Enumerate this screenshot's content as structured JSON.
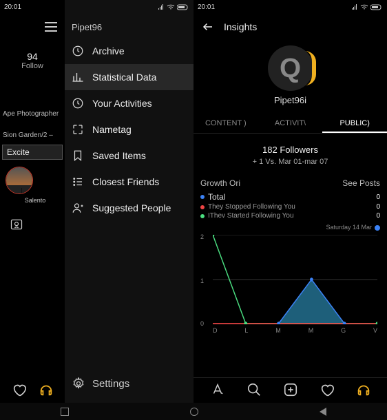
{
  "statusbar": {
    "time": "20:01"
  },
  "profile": {
    "follow_count": "94",
    "follow_label": "Follow",
    "role": "Ape Photographer",
    "location": "Sion Garden/2 –",
    "excite": "Excite",
    "story_label": "Salento"
  },
  "menu": {
    "username": "Pipet96",
    "items": [
      {
        "label": "Archive"
      },
      {
        "label": "Statistical Data"
      },
      {
        "label": "Your Activities"
      },
      {
        "label": "Nametag"
      },
      {
        "label": "Saved Items"
      },
      {
        "label": "Closest Friends"
      },
      {
        "label": "Suggested People"
      }
    ],
    "settings": "Settings"
  },
  "insights": {
    "title": "Insights",
    "username": "Pipet96i",
    "tabs": {
      "content": "CONTENT )",
      "activity": "ACTIVIT\\",
      "public": "PUBLIC)"
    },
    "followers": "182 Followers",
    "delta": "+ 1 Vs. Mar 01-mar 07",
    "growth_label": "Growth Ori",
    "see_posts": "See Posts",
    "legend_total": "Total",
    "legend_stopped": "They Stopped Following You",
    "legend_started": "IThev Started Following You",
    "date": "Saturday 14 Mar",
    "values": {
      "total": "0",
      "stopped": "0",
      "started": "0"
    }
  },
  "colors": {
    "accent": "#f0b020",
    "blue": "#3b82f6",
    "green": "#4ade80",
    "red": "#ef4444",
    "teal": "#1e5f7a"
  },
  "chart_data": {
    "type": "line",
    "categories": [
      "D",
      "L",
      "M",
      "M",
      "G",
      "V"
    ],
    "ylim": [
      0,
      2
    ],
    "yticks": [
      0,
      1,
      2
    ],
    "series": [
      {
        "name": "Total",
        "color": "#3b82f6",
        "values": [
          0,
          0,
          0,
          0,
          0,
          0
        ]
      },
      {
        "name": "Stopped",
        "color": "#ef4444",
        "values": [
          0,
          0,
          0,
          0,
          0,
          0
        ]
      },
      {
        "name": "Started",
        "color": "#4ade80",
        "values": [
          2,
          0,
          0,
          0,
          0,
          0
        ]
      }
    ],
    "area": {
      "color": "#1e5f7a",
      "points": [
        [
          2,
          0
        ],
        [
          3,
          1
        ],
        [
          4,
          0
        ]
      ]
    }
  }
}
